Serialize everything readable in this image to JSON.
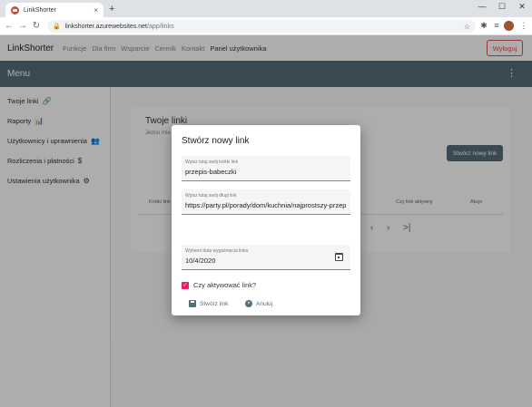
{
  "browser": {
    "tab_title": "LinkShorter",
    "tab_close": "×",
    "new_tab": "+",
    "window_controls": [
      "—",
      "☐",
      "✕"
    ],
    "url_host": "linkshorter.azurewebsites.net",
    "url_path": "/app/links",
    "nav_icons": [
      "arrow-left-icon",
      "arrow-right-icon",
      "reload-icon"
    ]
  },
  "navbar": {
    "brand": "LinkShorter",
    "links": [
      "Funkcje",
      "Dla firm",
      "Wsparcie",
      "Cennik",
      "Kontakt",
      "Panel użytkownika"
    ],
    "active_index": 5,
    "logout": "Wyloguj"
  },
  "menubar": {
    "title": "Menu",
    "more": "⋮"
  },
  "sidebar": {
    "items": [
      {
        "label": "Twoje linki",
        "icon": "link-icon",
        "glyph": "🔗"
      },
      {
        "label": "Raporty",
        "icon": "chart-icon",
        "glyph": "📊"
      },
      {
        "label": "Użytkownicy i uprawnienia",
        "icon": "users-icon",
        "glyph": "👥"
      },
      {
        "label": "Rozliczenia i płatności",
        "icon": "dollar-icon",
        "glyph": "$"
      },
      {
        "label": "Ustawienia użytkownika",
        "icon": "gears-icon",
        "glyph": "⚙"
      }
    ]
  },
  "card": {
    "title": "Twoje linki",
    "subtitle": "Jedno mie",
    "create_button": "Stwórz nowy link",
    "columns": [
      "Krótki link",
      "Czy link aktywny",
      "Akcje"
    ],
    "pager": [
      "‹",
      "›",
      ">|"
    ]
  },
  "dialog": {
    "title": "Stwórz nowy link",
    "short_link": {
      "label": "Wpisz tutaj swój krótki link",
      "value": "przepis-babeczki"
    },
    "long_link": {
      "label": "Wpisz tutaj swój długi link",
      "value": "https://party.pl/porady/dom/kuchnia/najprostszy-przep"
    },
    "expiry": {
      "label": "Wybierz datę wygaśnięcia linku",
      "value": "10/4/2020"
    },
    "active_checkbox": {
      "label": "Czy aktywować link?",
      "checked": true,
      "mark": "✓"
    },
    "submit": "Stwórz link",
    "cancel": "Anuluj",
    "cancel_mark": "×"
  },
  "colors": {
    "primary": "#546e7a",
    "accent": "#e91e63",
    "danger": "#d9534f"
  }
}
